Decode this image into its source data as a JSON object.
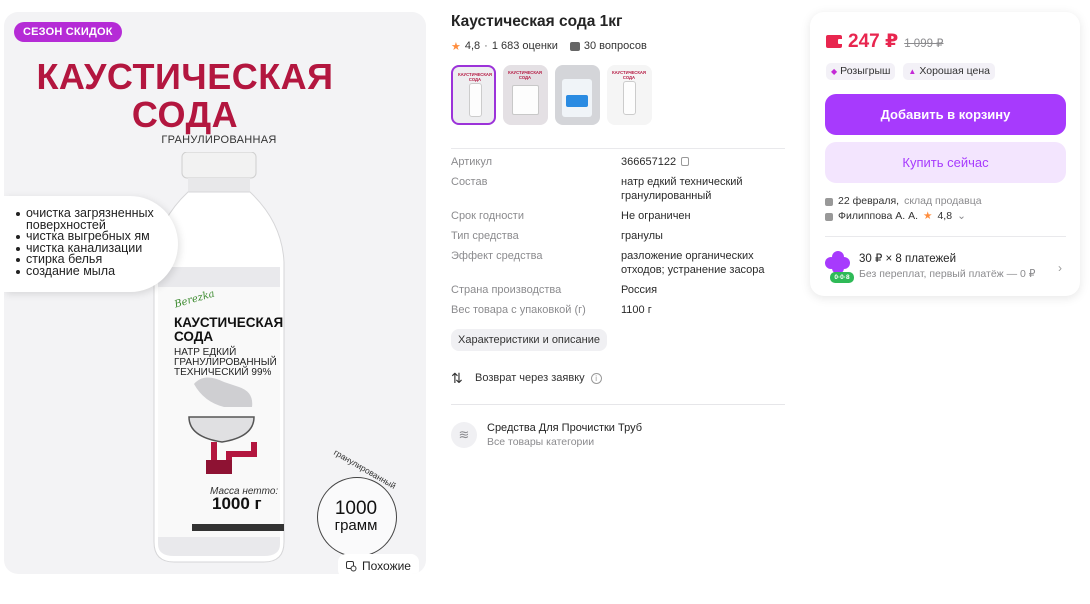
{
  "image": {
    "season_badge": "СЕЗОН СКИДОК",
    "hero_title": "КАУСТИЧЕСКАЯ СОДА",
    "hero_subtitle": "ГРАНУЛИРОВАННАЯ",
    "features": [
      "очистка загрязненных поверхностей",
      "чистка выгребных ям",
      "чистка канализации",
      "стирка белья",
      "создание мыла"
    ],
    "label_brand": "Berezka",
    "label_name": "КАУСТИЧЕСКАЯ СОДА",
    "label_desc": "НАТР ЕДКИЙ ГРАНУЛИРОВАННЫЙ ТЕХНИЧЕСКИЙ 99%",
    "label_mass": "Масса нетто:",
    "label_weight": "1000 г",
    "stamp_top": "гранулированный",
    "stamp_number": "1000",
    "stamp_unit": "грамм",
    "similar_label": "Похожие"
  },
  "product": {
    "title": "Каустическая сода 1кг",
    "rating": "4,8",
    "ratings_count": "1 683 оценки",
    "questions": "30 вопросов",
    "thumb_title": "КАУСТИЧЕСКАЯ СОДА"
  },
  "specs": [
    {
      "key": "Артикул",
      "value": "366657122"
    },
    {
      "key": "Состав",
      "value": "натр едкий технический гранулированный"
    },
    {
      "key": "Срок годности",
      "value": "Не ограничен"
    },
    {
      "key": "Тип средства",
      "value": "гранулы"
    },
    {
      "key": "Эффект средства",
      "value": "разложение органических отходов; устранение засора"
    },
    {
      "key": "Страна производства",
      "value": "Россия"
    },
    {
      "key": "Вес товара с упаковкой (г)",
      "value": "1100 г"
    }
  ],
  "characteristics_button": "Характеристики и описание",
  "return_label": "Возврат через заявку",
  "category": {
    "name": "Средства Для Прочистки Труб",
    "sub": "Все товары категории"
  },
  "buy": {
    "price": "247 ₽",
    "old_price": "1 099 ₽",
    "badge_raffle": "Розыгрыш",
    "badge_price": "Хорошая цена",
    "add_to_cart": "Добавить в корзину",
    "buy_now": "Купить сейчас",
    "delivery_date": "22 февраля,",
    "delivery_source": "склад продавца",
    "seller_name": "Филиппова А. А.",
    "seller_rating": "4,8",
    "installment_title": "30 ₽ × 8 платежей",
    "installment_sub": "Без переплат, первый платёж — 0 ₽",
    "installment_badge": "0·0·8"
  },
  "colors": {
    "accent": "#a73afd",
    "price": "#e8264f",
    "brand_title": "#b3163f",
    "badge": "#b52bd6"
  }
}
